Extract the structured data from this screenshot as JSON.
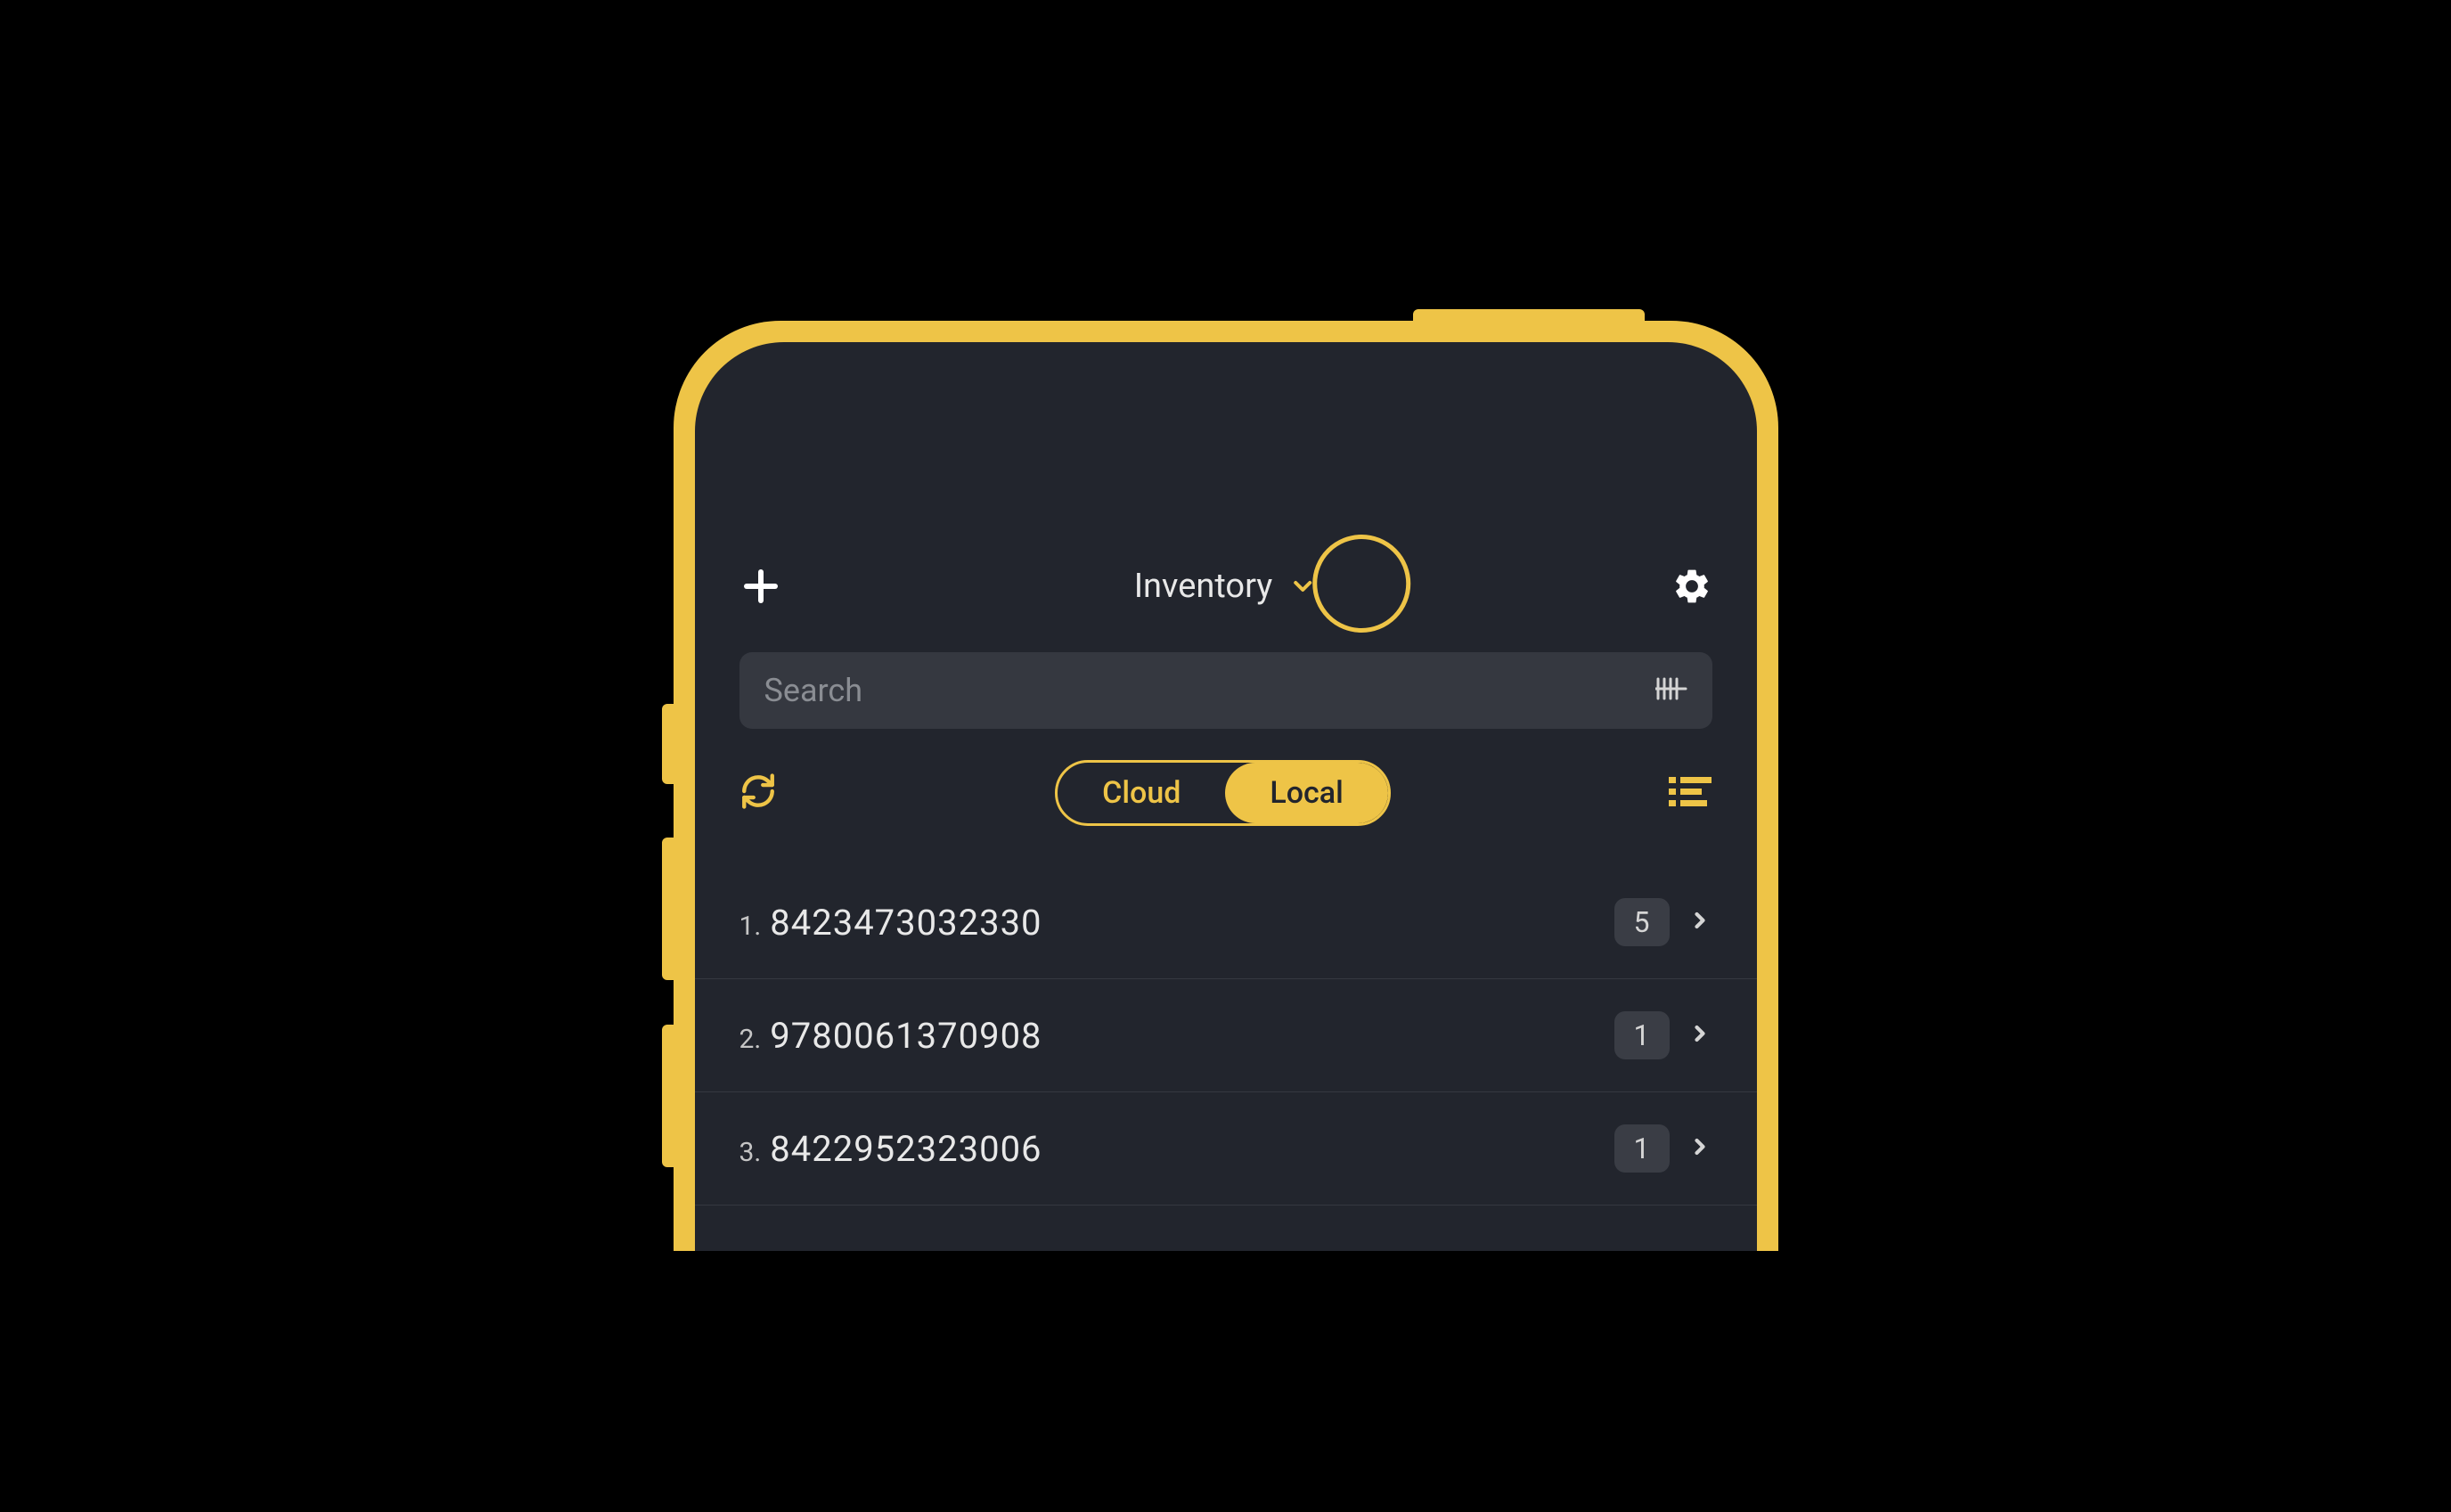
{
  "header": {
    "title": "Inventory"
  },
  "search": {
    "placeholder": "Search"
  },
  "segments": {
    "cloud": "Cloud",
    "local": "Local"
  },
  "items": [
    {
      "index": "1.",
      "code": "8423473032330",
      "count": "5"
    },
    {
      "index": "2.",
      "code": "9780061370908",
      "count": "1"
    },
    {
      "index": "3.",
      "code": "8422952323006",
      "count": "1"
    }
  ]
}
